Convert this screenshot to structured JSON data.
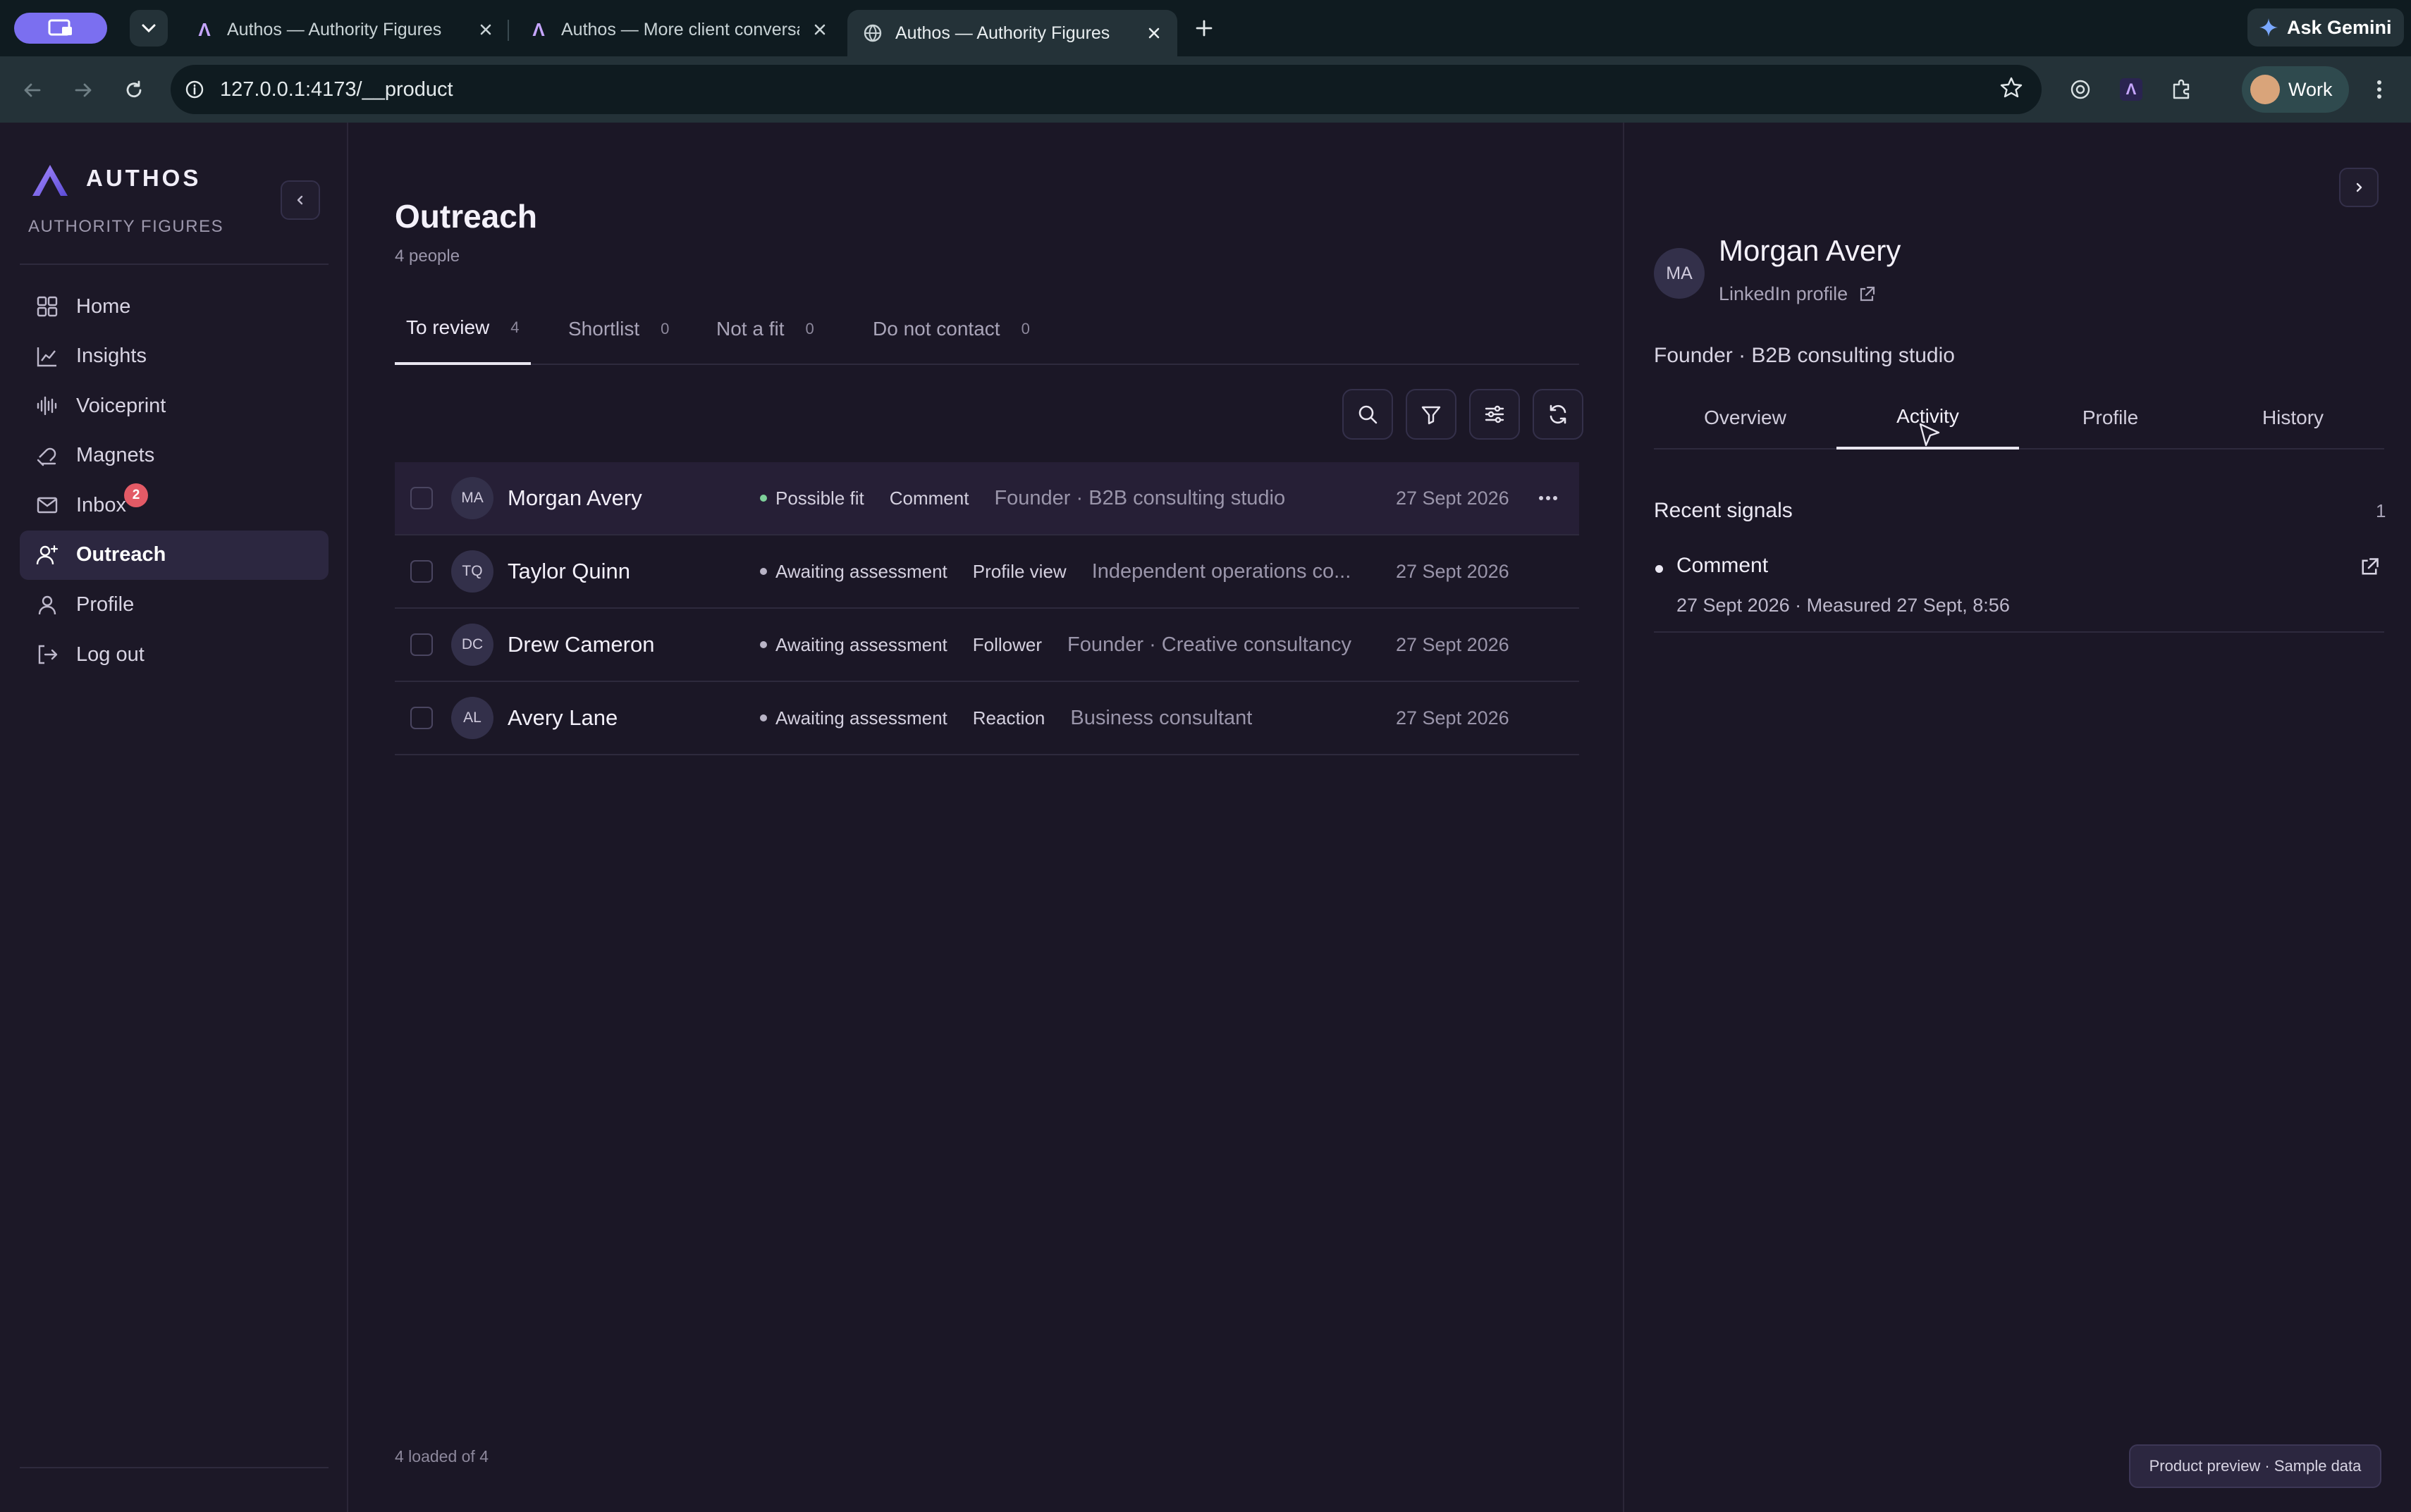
{
  "browser": {
    "tabs": [
      {
        "title": "Authos — Authority Figures"
      },
      {
        "title": "Authos — More client conversations"
      },
      {
        "title": "Authos — Authority Figures"
      }
    ],
    "url": "127.0.0.1:4173/__product",
    "gemini_label": "Ask Gemini",
    "profile_label": "Work"
  },
  "sidebar": {
    "brand": "AUTHOS",
    "workspace": "AUTHORITY FIGURES",
    "items": [
      {
        "label": "Home",
        "icon": "grid-icon"
      },
      {
        "label": "Insights",
        "icon": "chart-icon"
      },
      {
        "label": "Voiceprint",
        "icon": "waveform-icon"
      },
      {
        "label": "Magnets",
        "icon": "magnet-icon"
      },
      {
        "label": "Inbox",
        "icon": "mail-icon",
        "badge": "2"
      },
      {
        "label": "Outreach",
        "icon": "user-plus-icon",
        "active": true
      },
      {
        "label": "Profile",
        "icon": "user-icon"
      },
      {
        "label": "Log out",
        "icon": "logout-icon"
      }
    ]
  },
  "main": {
    "title": "Outreach",
    "subtitle": "4 people",
    "tabs": [
      {
        "label": "To review",
        "count": "4"
      },
      {
        "label": "Shortlist",
        "count": "0"
      },
      {
        "label": "Not a fit",
        "count": "0"
      },
      {
        "label": "Do not contact",
        "count": "0"
      }
    ],
    "rows": [
      {
        "initials": "MA",
        "name": "Morgan Avery",
        "status": "Possible fit",
        "status_color": "#7ed09a",
        "signal": "Comment",
        "role": "Founder · B2B consulting studio",
        "date": "27 Sept 2026"
      },
      {
        "initials": "TQ",
        "name": "Taylor Quinn",
        "status": "Awaiting assessment",
        "status_color": "#b9b4c6",
        "signal": "Profile view",
        "role": "Independent operations co...",
        "date": "27 Sept 2026"
      },
      {
        "initials": "DC",
        "name": "Drew Cameron",
        "status": "Awaiting assessment",
        "status_color": "#b9b4c6",
        "signal": "Follower",
        "role": "Founder · Creative consultancy",
        "date": "27 Sept 2026"
      },
      {
        "initials": "AL",
        "name": "Avery Lane",
        "status": "Awaiting assessment",
        "status_color": "#b9b4c6",
        "signal": "Reaction",
        "role": "Business consultant",
        "date": "27 Sept 2026"
      }
    ],
    "footer": "4 loaded of 4"
  },
  "detail": {
    "initials": "MA",
    "name": "Morgan Avery",
    "link_label": "LinkedIn profile",
    "role": "Founder · B2B consulting studio",
    "tabs": [
      "Overview",
      "Activity",
      "Profile",
      "History"
    ],
    "active_tab": "Activity",
    "section_title": "Recent signals",
    "section_count": "1",
    "signals": [
      {
        "title": "Comment",
        "meta": "27 Sept 2026 · Measured 27 Sept, 8:56"
      }
    ],
    "preview_label": "Product preview · Sample data"
  }
}
